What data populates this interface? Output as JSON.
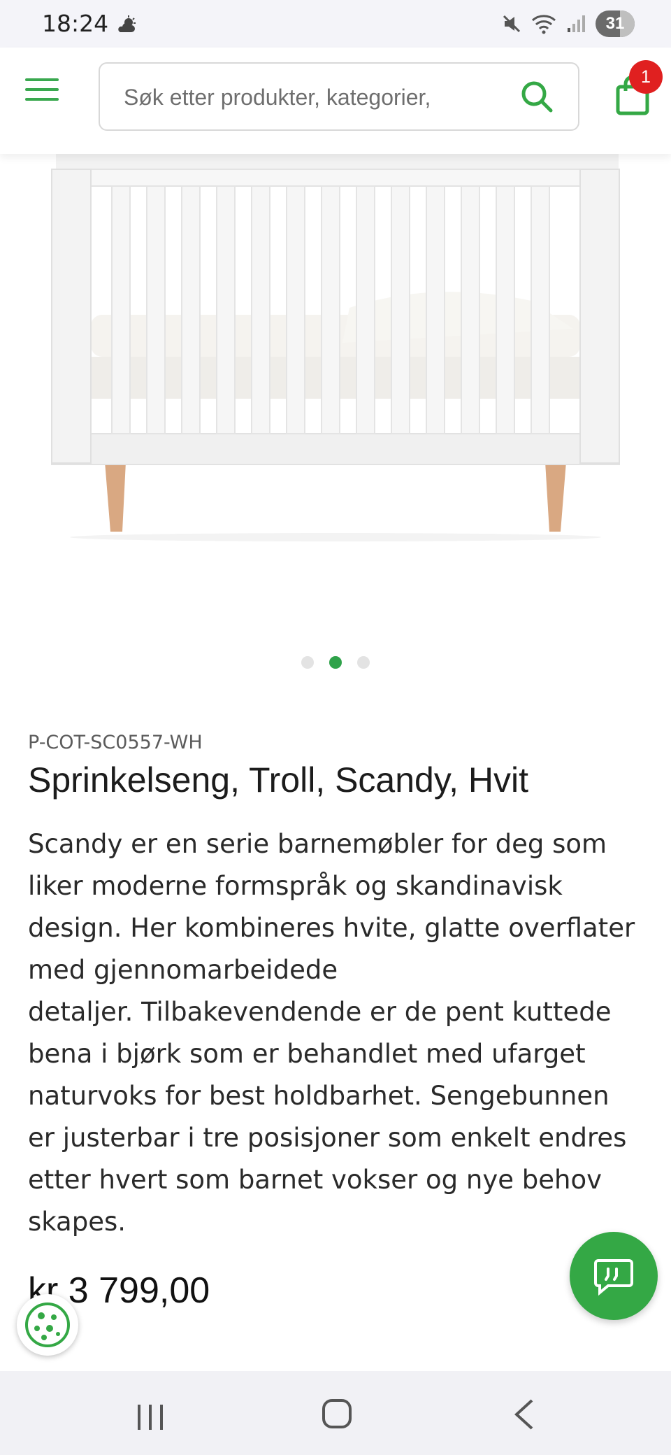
{
  "status_bar": {
    "time": "18:24",
    "battery": "31",
    "weather_icon": "cloud-sun-icon",
    "icons": [
      "mute-icon",
      "wifi-icon",
      "signal-icon",
      "battery-icon"
    ]
  },
  "header": {
    "menu_icon": "hamburger-menu-icon",
    "search_placeholder": "Søk etter produkter, kategorier,",
    "search_icon": "search-icon",
    "cart_icon": "shopping-bag-icon",
    "cart_count": "1"
  },
  "gallery": {
    "image_alt": "Sprinkelseng, Troll, Scandy, Hvit",
    "total_slides": 3,
    "active_slide": 2
  },
  "product": {
    "sku": "P-COT-SC0557-WH",
    "title": "Sprinkelseng, Troll, Scandy, Hvit",
    "description_lines": [
      "Scandy er en serie barnemøbler for deg som",
      "liker moderne formspråk og skandinavisk",
      "design. Her kombineres hvite, glatte overflater",
      "med gjennomarbeidede",
      "detaljer. Tilbakevendende er de pent kuttede",
      "bena i bjørk som er behandlet med ufarget",
      "naturvoks for best holdbarhet. Sengebunnen",
      "er justerbar i tre posisjoner som enkelt endres",
      "etter hvert som barnet vokser og nye behov",
      "skapes."
    ],
    "price": "kr 3 799,00"
  },
  "floating": {
    "cookie_icon": "cookie-icon",
    "chat_icon": "chat-bubble-icon"
  },
  "colors": {
    "accent": "#34a845",
    "badge": "#e02020"
  }
}
